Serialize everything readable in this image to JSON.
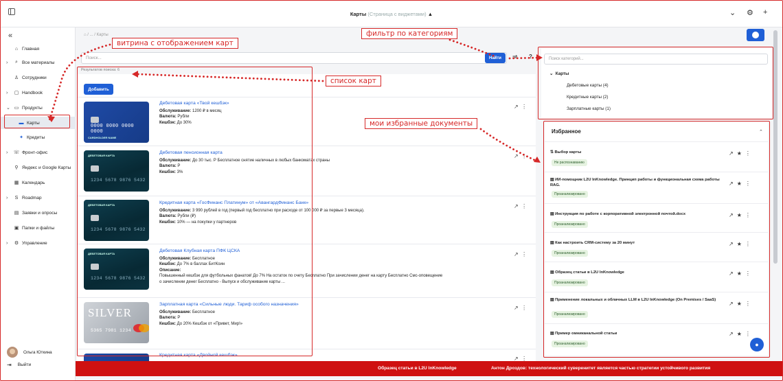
{
  "topbar": {
    "title": "Карты",
    "subtitle": "(Страница с виджетами)",
    "chevron": "▲"
  },
  "sidebar": {
    "collapse": "«",
    "items": [
      {
        "label": "Главная",
        "icon": "home-icon",
        "glyph": "⌂"
      },
      {
        "label": "Все материалы",
        "icon": "search-icon",
        "glyph": "⌕"
      },
      {
        "label": "Сотрудники",
        "icon": "person-icon",
        "glyph": "♙"
      },
      {
        "label": "Handbook",
        "icon": "book-icon",
        "glyph": "▢"
      },
      {
        "label": "Продукты",
        "icon": "folder-icon",
        "glyph": "▭"
      },
      {
        "label": "Карты",
        "icon": "card-icon",
        "glyph": "▬"
      },
      {
        "label": "Кредиты",
        "icon": "credit-icon",
        "glyph": "✦"
      },
      {
        "label": "Фронт-офис",
        "icon": "phone-icon",
        "glyph": "☏"
      },
      {
        "label": "Яндекс и Google Карты",
        "icon": "pin-icon",
        "glyph": "⚲"
      },
      {
        "label": "Календарь",
        "icon": "calendar-icon",
        "glyph": "▦"
      },
      {
        "label": "Roadmap",
        "icon": "route-icon",
        "glyph": "S"
      },
      {
        "label": "Заявки и опросы",
        "icon": "clipboard-icon",
        "glyph": "▤"
      },
      {
        "label": "Папки и файлы",
        "icon": "folders-icon",
        "glyph": "▣"
      },
      {
        "label": "Управление",
        "icon": "settings-icon",
        "glyph": "⚙"
      }
    ],
    "user": "Ольга Юткина",
    "logout": "Выйти"
  },
  "main": {
    "breadcrumbs": "⌂  /  ...  /  Карты",
    "search_placeholder": "Поиск...",
    "find_label": "Найти",
    "help": "?",
    "results": "Результатов поиска: 6",
    "add_label": "Добавить",
    "cards": [
      {
        "title": "Дебетовая карта «Твой кешбэк»",
        "image": "blue",
        "lines": [
          [
            "Обслуживание:",
            "1200 ₽ в месяц"
          ],
          [
            "Валюта:",
            "Рубли"
          ],
          [
            "Кешбэк:",
            "До 30%"
          ]
        ],
        "number": "0000 0000 0000 0000"
      },
      {
        "title": "Дебетовая пенсионная карта",
        "image": "dark",
        "lines": [
          [
            "Обслуживание:",
            "До 30 тыс. Р Бесплатное снятие наличных в любых банкоматах страны"
          ],
          [
            "Валюта:",
            "Р"
          ],
          [
            "Кешбэк:",
            "3%"
          ]
        ],
        "number": "1234 5678 9876 5432"
      },
      {
        "title": "Кредитная карта «ГосФинанс Платинум» от «АвангардФинанс Банк»",
        "image": "dark",
        "lines": [
          [
            "Обслуживание:",
            "3 990 рублей в год (первый год бесплатно при расходе от 100 000 ₽ за первые 3 месяца)."
          ],
          [
            "Валюта:",
            "Рубли (₽)"
          ],
          [
            "Кешбэк:",
            "10% — на покупки у партнеров"
          ]
        ],
        "number": "1234 5678 9876 5432"
      },
      {
        "title": "Дебетовая Клубная карта ПФК ЦСКА",
        "image": "dark",
        "lines": [
          [
            "Обслуживание:",
            "Бесплатное"
          ],
          [
            "Кешбэк:",
            "До 7% в баллах БитКоин"
          ],
          [
            "Описание:",
            ""
          ],
          [
            "",
            "Повышенный кешбэк для футбольных фанатов! До 7%  На остаток по счету    Бесплатно При зачислении денег на карту  Бесплатно Смс-оповещение"
          ],
          [
            "",
            "о зачислении денег   Бесплатно - Выпуск и обслуживание  карты  ..."
          ]
        ],
        "number": "1234 5678 9876 5432"
      },
      {
        "title": "Зарплатная карта «Сильные люди. Тариф особого назначения»",
        "image": "silver",
        "lines": [
          [
            "Обслуживание:",
            "Бесплатное"
          ],
          [
            "Валюта:",
            "Р"
          ],
          [
            "Кешбэк:",
            "До 20% Кешбэк от «Привет, Мир!»"
          ]
        ],
        "number": "5365 7981 1234"
      },
      {
        "title": "Кредитная карта «Двойной кешбэк»",
        "image": "blue",
        "lines": [],
        "number": ""
      }
    ],
    "card_label_dark": "ДЕБЕТОВАЯ КАРТА",
    "card_label_silver": "SILVER",
    "card_label_blue": "CARDHOLDER NAME"
  },
  "categories": {
    "search_placeholder": "Поиск категорий...",
    "root": "Карты",
    "items": [
      "Дебетовые карты (4)",
      "Кредитные карты (2)",
      "Зарплатные карты (1)"
    ]
  },
  "favorites": {
    "title": "Избранное",
    "items": [
      {
        "title": "Выбор карты",
        "badge": "Не распознаванию",
        "icon": "flow-icon"
      },
      {
        "title": "ИИ-помощник L2U InKnowledge. Принцип работы и функциональная схема работы RAG.",
        "badge": "Проанализировано",
        "icon": "doc-icon"
      },
      {
        "title": "Инструкция по работе с корпоративной электронной почтой.docx",
        "badge": "Проанализировано",
        "icon": "doc-icon"
      },
      {
        "title": "Как настроить CRM-систему за 20 минут",
        "badge": "Проанализировано",
        "icon": "doc-icon"
      },
      {
        "title": "Образец статьи в L2U InKnowledge",
        "badge": "Проанализировано",
        "icon": "doc-icon"
      },
      {
        "title": "Применение локальных и облачных LLM в L2U InKnowledge (On Premises / SaaS)",
        "badge": "Проанализировано",
        "icon": "doc-icon"
      },
      {
        "title": "Пример омниканальной статьи",
        "badge": "Проанализировано",
        "icon": "doc-icon"
      }
    ]
  },
  "ticker": {
    "item1": "Образец статьи в L2U InKnowledge",
    "item2": "Антон Дроздов: технологический суверенитет является частью стратегии устойчивого развития"
  },
  "annotations": {
    "showcase": "витрина с отображением карт",
    "filter": "фильтр по категориям",
    "list": "список карт",
    "favorites": "мои избранные документы"
  },
  "colors": {
    "accent": "#1f5fd6",
    "annotation": "#d62828",
    "ticker": "#cf1111"
  }
}
